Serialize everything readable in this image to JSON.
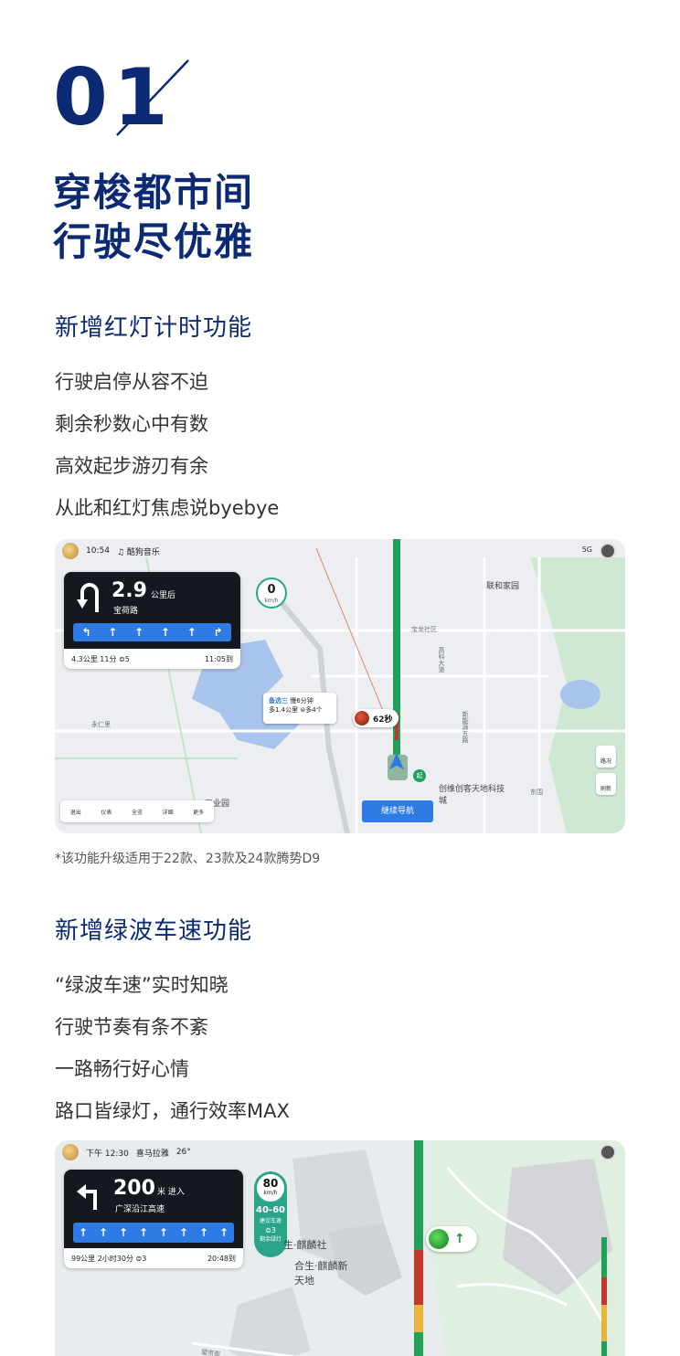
{
  "hero": {
    "number_a": "0",
    "number_b": "1"
  },
  "title_lines": [
    "穿梭都市间",
    "行驶尽优雅"
  ],
  "section1": {
    "heading": "新增红灯计时功能",
    "lines": [
      "行驶启停从容不迫",
      "剩余秒数心中有数",
      "高效起步游刃有余",
      "从此和红灯焦虑说byebye"
    ],
    "footnote": "*该功能升级适用于22款、23款及24款腾势D9"
  },
  "screen1": {
    "status": {
      "time": "10:54",
      "music": "♫ 酷狗音乐",
      "signal": "5G"
    },
    "nav": {
      "distance": "2.9",
      "unit": "公里后",
      "road": "宝荷路",
      "lanes": [
        "↰",
        "↑",
        "↑",
        "↑",
        "↑",
        "↱"
      ],
      "remaining": "4.3公里 11分 ⊜5",
      "arrive": "11:05到"
    },
    "speed": {
      "value": "0",
      "unit": "km/h"
    },
    "route_tip": {
      "tag": "备选三",
      "slow": "慢6分钟",
      "detail": "多1.4公里 ⊜多4个"
    },
    "red_light": {
      "seconds": "62秒"
    },
    "continue_button": "继续导航",
    "tools": [
      "退出",
      "仪表",
      "全览",
      "详细",
      "更多"
    ],
    "side_buttons": [
      "路况",
      "刷新"
    ],
    "labels": {
      "lianhe": "联和家园",
      "baolong": "宝龙社区",
      "gaoke": "高科大道",
      "yongren": "永仁里",
      "xinlian": "新能源五路",
      "chuangwei": "创维创客天地科技城",
      "gongye": "工业园",
      "dongwei": "东围",
      "start": "起"
    }
  },
  "section2": {
    "heading": "新增绿波车速功能",
    "lines": [
      "“绿波车速”实时知晓",
      "行驶节奏有条不紊",
      "一路畅行好心情",
      "路口皆绿灯，通行效率MAX"
    ]
  },
  "screen2": {
    "status": {
      "time": "下午 12:30",
      "music": "喜马拉雅",
      "weather": "26°"
    },
    "nav": {
      "distance": "200",
      "unit": "米 进入",
      "road": "广深沿江高速",
      "lanes": [
        "↑",
        "↑",
        "↑",
        "↑",
        "↑",
        "↑",
        "↑",
        "↑"
      ],
      "remaining": "99公里 2小时30分 ⊜3",
      "arrive": "20:48到"
    },
    "green_wave": {
      "limit": "80",
      "limit_unit": "km/h",
      "range": "40-60",
      "range_label": "建议车速",
      "lights": "⊜3",
      "lights_label": "剩余绿灯"
    },
    "labels": {
      "qilin1": "生·麒麟社",
      "qilin2": "合生·麒麟新天地",
      "street": "望京街"
    }
  },
  "colors": {
    "brand": "#0b2a73",
    "route_green": "#21a05a",
    "accent_blue": "#2f7be5"
  }
}
